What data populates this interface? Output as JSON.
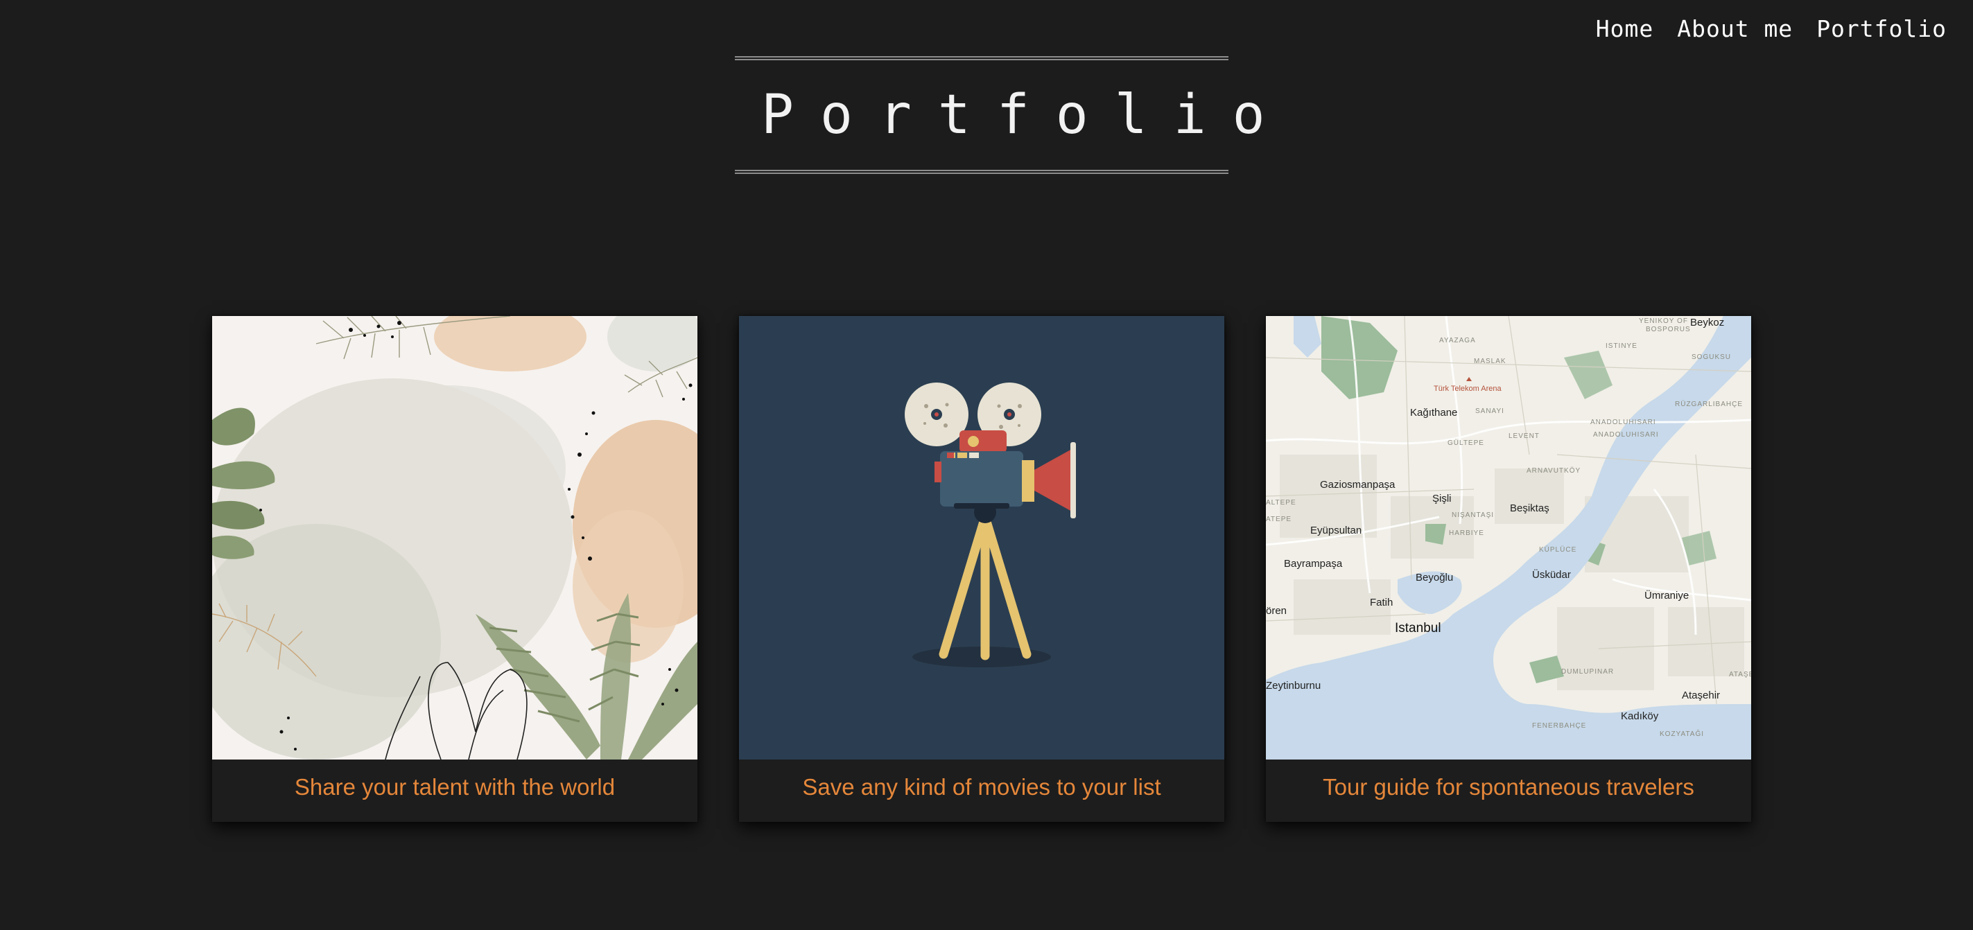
{
  "nav": {
    "home": "Home",
    "about": "About me",
    "portfolio": "Portfolio"
  },
  "page": {
    "title": "Portfolio"
  },
  "colors": {
    "background": "#1c1c1c",
    "caption_accent": "#e5873a",
    "card_movie_bg": "#2b3e51"
  },
  "cards": [
    {
      "caption": "Share your talent with the world",
      "image": "botanical-watercolor-illustration"
    },
    {
      "caption": "Save any kind of movies to your list",
      "image": "movie-camera-icon"
    },
    {
      "caption": "Tour guide for spontaneous travelers",
      "image": "istanbul-map-illustration"
    }
  ],
  "map_labels": {
    "beykoz": "Beykoz",
    "kagithane": "Kağıthane",
    "gaziosmanpasa": "Gaziosmanpaşa",
    "sisli": "Şişli",
    "besiktas": "Beşiktaş",
    "eyupsultan": "Eyüpsultan",
    "bayrampasa": "Bayrampaşa",
    "beyoglu": "Beyoğlu",
    "uskudar": "Üsküdar",
    "umraniye": "Ümraniye",
    "fatih": "Fatih",
    "istanbul": "Istanbul",
    "zeytinburnu": "Zeytinburnu",
    "atasehir": "Ataşehir",
    "kadikoy": "Kadıköy",
    "turk_telekom": "Türk Telekom Arena",
    "yenikoy": "YENIKOY OF",
    "bosporus": "BOSPORUS",
    "istinye": "ISTINYE",
    "sogucu": "SOGUKSU",
    "rumeli": "RÜZGARLIBAHÇE",
    "ayazaga": "AYAZAGA",
    "maslak": "MASLAK",
    "sanayi": "SANAYI",
    "gultepe": "GÜLTEPE",
    "levent": "LEVENT",
    "anadolu1": "ANADOLUHISARI",
    "anadolu2": "ANADOLUHISARI",
    "arnavutkoy": "ARNAVUTKÖY",
    "nisantasi": "NIŞANTAŞI",
    "harbiye": "HARBIYE",
    "kuplice": "KÜPLÜCE",
    "alibeykoy": "ALTEPE",
    "dumlupinar": "DUMLUPINAR",
    "fenerbahce": "FENERBAHÇE",
    "kozyatagi": "KOZYATAĞI",
    "ataser": "ATAŞE",
    "oren": "ören",
    "atepe": "ATEPE"
  }
}
